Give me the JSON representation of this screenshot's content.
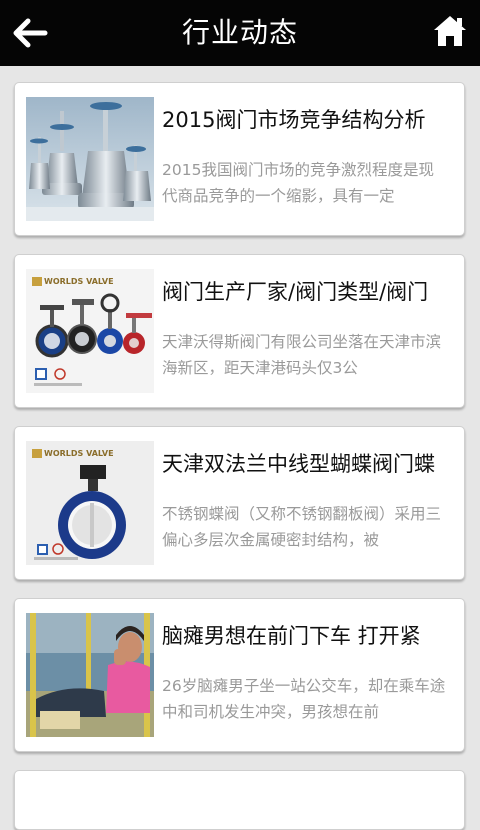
{
  "header": {
    "title": "行业动态",
    "back_icon": "back-arrow-icon",
    "home_icon": "home-icon"
  },
  "articles": [
    {
      "title": "2015阀门市场竞争结构分析",
      "summary": "2015我国阀门市场的竞争激烈程度是现代商品竞争的一个缩影，具有一定",
      "thumbnail": "gate-valves-photo"
    },
    {
      "title": "阀门生产厂家/阀门类型/阀门",
      "summary": "天津沃得斯阀门有限公司坐落在天津市滨海新区，距天津港码头仅3公",
      "thumbnail": "butterfly-valves-photo",
      "brand_text": "WORLDS VALVE"
    },
    {
      "title": "天津双法兰中线型蝴蝶阀门蝶",
      "summary": "不锈钢蝶阀（又称不锈钢翻板阀）采用三偏心多层次金属硬密封结构，被",
      "thumbnail": "flanged-butterfly-valve-photo",
      "brand_text": "WORLDS VALVE"
    },
    {
      "title": "脑瘫男想在前门下车 打开紧",
      "summary": "26岁脑瘫男子坐一站公交车，却在乘车途中和司机发生冲突，男孩想在前",
      "thumbnail": "bus-passenger-photo"
    }
  ],
  "colors": {
    "topbar": "#050505",
    "page_background": "#e6e6e6",
    "card_background": "#ffffff",
    "title_text": "#111111",
    "summary_text": "#9a9a9a"
  }
}
